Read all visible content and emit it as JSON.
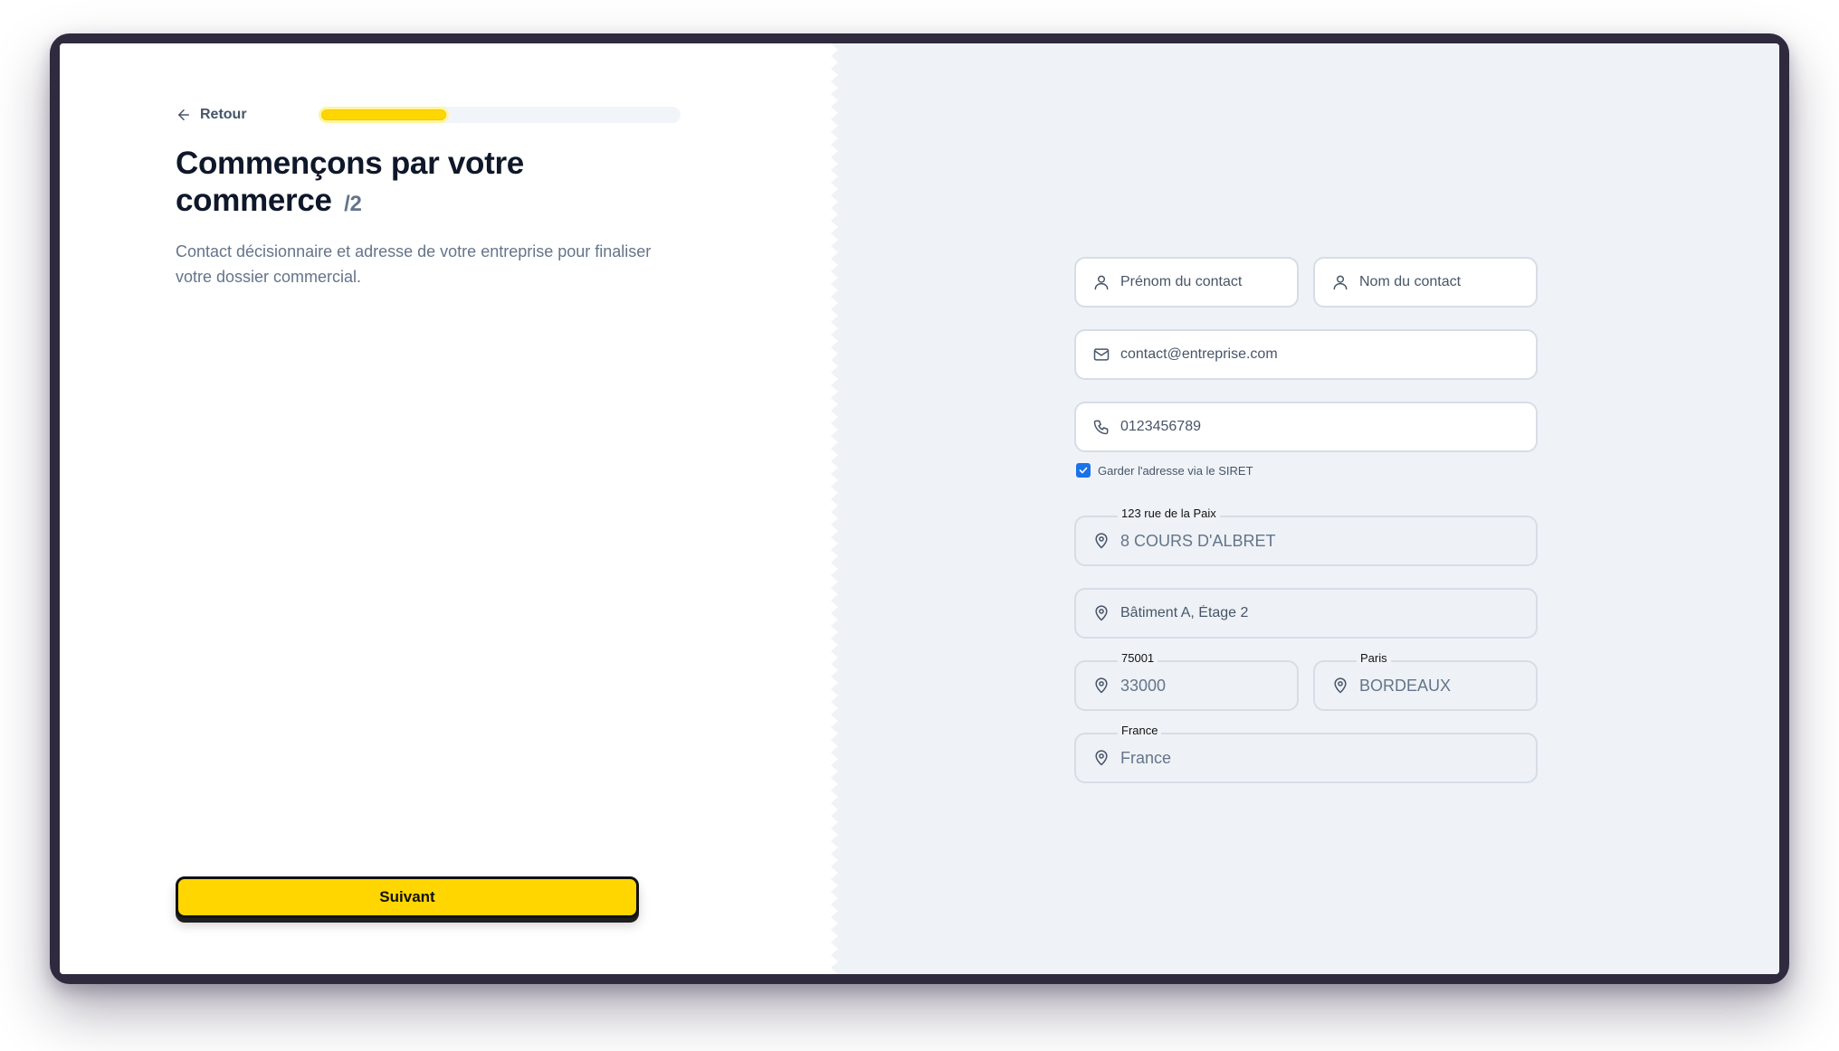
{
  "nav": {
    "back_label": "Retour"
  },
  "progress": {
    "value": 0.36
  },
  "header": {
    "title": "Commençons par votre commerce",
    "step": "/2",
    "subtitle": "Contact décisionnaire et adresse de votre entreprise pour finaliser votre dossier commercial."
  },
  "form": {
    "first_name": {
      "placeholder": "Prénom du contact",
      "value": ""
    },
    "last_name": {
      "placeholder": "Nom du contact",
      "value": ""
    },
    "email": {
      "placeholder": "contact@entreprise.com",
      "value": ""
    },
    "phone": {
      "placeholder": "0123456789",
      "value": ""
    },
    "keep_siret_address": {
      "label": "Garder l'adresse via le SIRET",
      "checked": true
    },
    "address_line1": {
      "label": "123 rue de la Paix",
      "value": "8 COURS D'ALBRET"
    },
    "address_line2": {
      "placeholder": "Bâtiment A, Étage 2",
      "value": ""
    },
    "postal_code": {
      "label": "75001",
      "value": "33000"
    },
    "city": {
      "label": "Paris",
      "value": "BORDEAUX"
    },
    "country": {
      "label": "France",
      "value": "France"
    }
  },
  "actions": {
    "next_label": "Suivant"
  },
  "colors": {
    "accent": "#ffd600",
    "checkbox": "#1a73e8",
    "panel": "#eff3f8"
  },
  "icons": {
    "back": "arrow-left-icon",
    "person": "user-icon",
    "email": "mail-icon",
    "phone": "phone-icon",
    "location": "map-pin-icon",
    "check": "check-icon"
  }
}
